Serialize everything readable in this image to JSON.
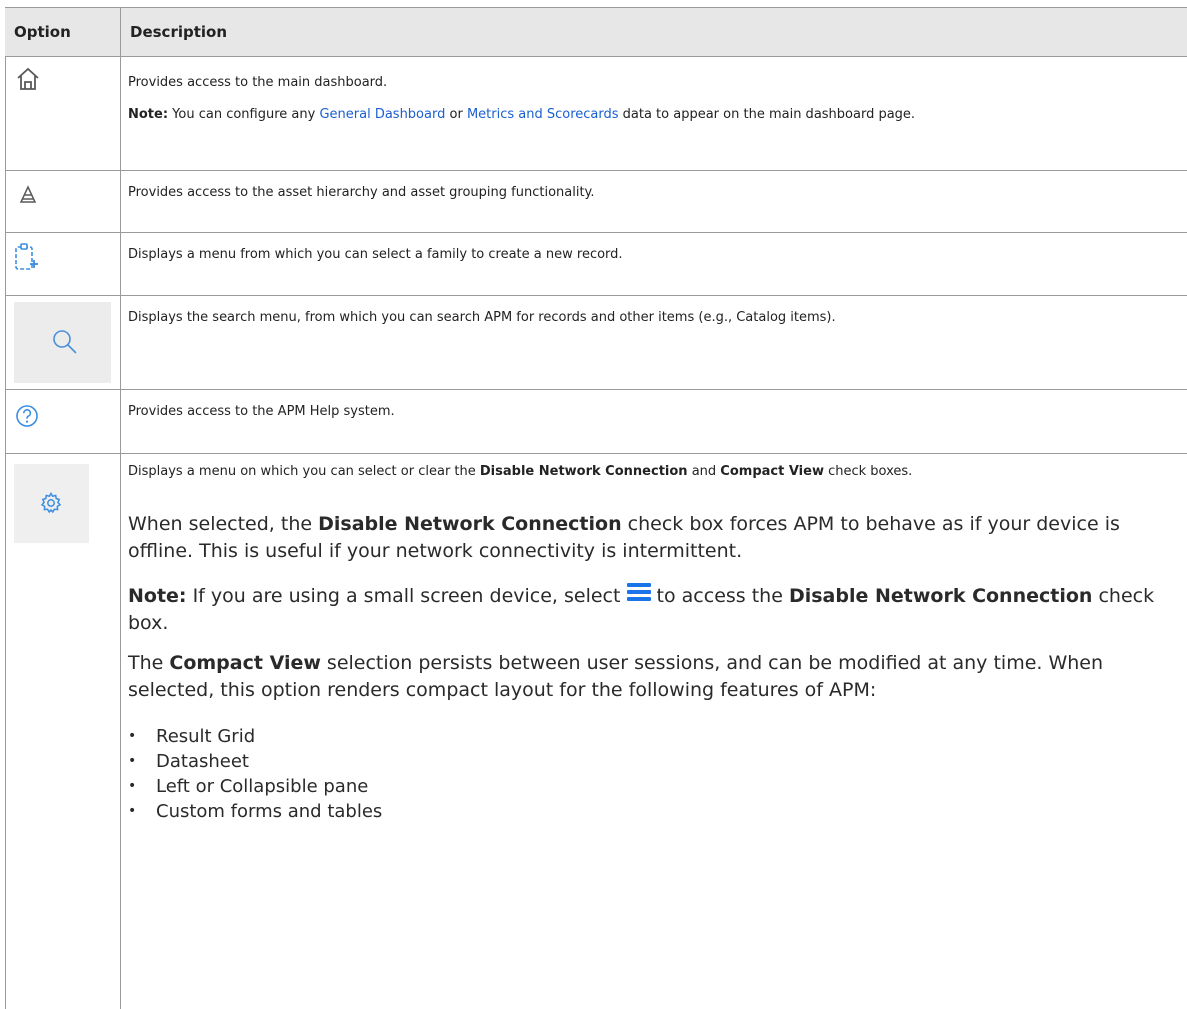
{
  "table": {
    "headers": {
      "option": "Option",
      "description": "Description"
    }
  },
  "rows": [
    {
      "icon": "home-icon",
      "text": "Provides access to the main dashboard.",
      "note": {
        "label": "Note:",
        "pre": " You can configure any ",
        "link1": "General Dashboard",
        "mid": " or ",
        "link2": "Metrics and Scorecards",
        "post": " data to appear on the main dashboard page."
      }
    },
    {
      "icon": "hierarchy-pyramid-icon",
      "text": "Provides access to the asset hierarchy and asset grouping functionality."
    },
    {
      "icon": "new-record-icon",
      "text": "Displays a menu from which you can select a family to create a new record."
    },
    {
      "icon": "search-icon",
      "text": "Displays the search menu, from which you can search APM for records and other items (e.g., Catalog items)."
    },
    {
      "icon": "help-icon",
      "text": "Provides access to the APM Help system."
    },
    {
      "icon": "gear-icon",
      "intro": {
        "pre": "Displays a menu on which you can select or clear the ",
        "b1": "Disable Network Connection",
        "mid": " and ",
        "b2": "Compact View",
        "post": " check boxes."
      },
      "para1": {
        "pre": "When selected, the ",
        "b": "Disable Network Connection",
        "post": " check box forces APM to behave as if your device is offline. This is useful if your network connectivity is intermittent."
      },
      "para2": {
        "label": "Note:",
        "pre": " If you are using a small screen device, select ",
        "icon": "hamburger-menu-icon",
        "mid": " to access the ",
        "b": "Disable Network Connection",
        "post": " check box."
      },
      "para3": {
        "pre": "The ",
        "b": "Compact View",
        "post": " selection persists between user sessions, and can be modified at any time. When selected, this option renders compact layout for the following features of APM:"
      },
      "list": [
        "Result Grid",
        "Datasheet",
        "Left or Collapsible pane",
        "Custom forms and tables"
      ]
    }
  ],
  "colors": {
    "header_bg": "#e7e7e7",
    "border": "#9a9a9a",
    "link": "#1a5fd0",
    "icon": "#5a5a5a",
    "icon_blue": "#1a73e8"
  }
}
